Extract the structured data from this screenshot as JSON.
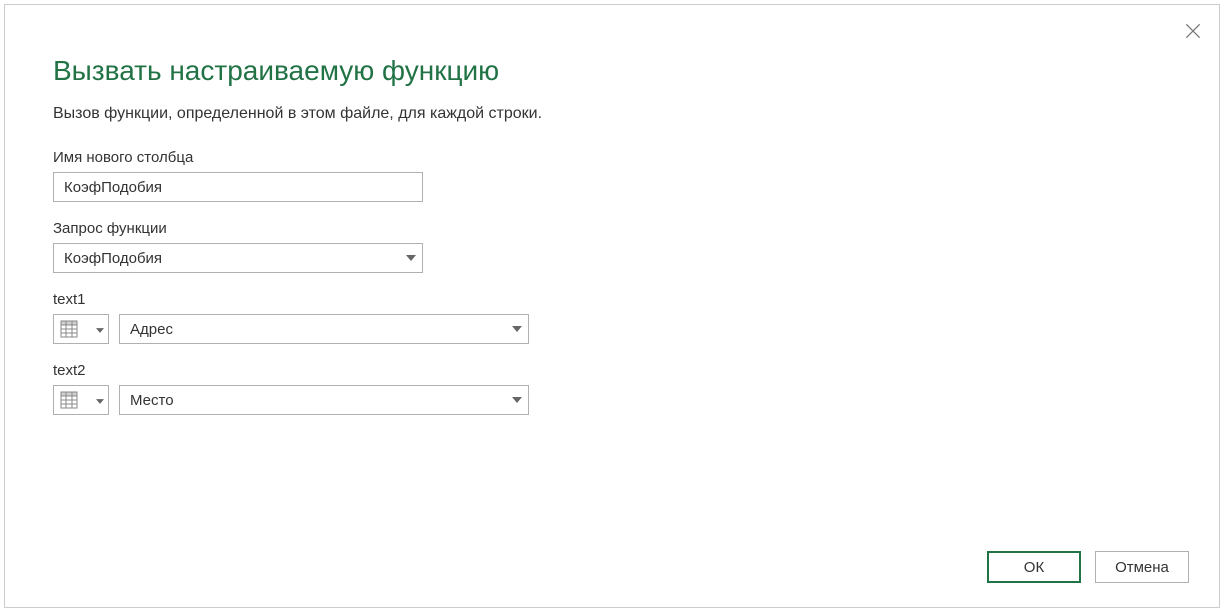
{
  "dialog": {
    "title": "Вызвать настраиваемую функцию",
    "subtitle": "Вызов функции, определенной в этом файле, для каждой строки."
  },
  "fields": {
    "column_name_label": "Имя нового столбца",
    "column_name_value": "КоэфПодобия",
    "function_query_label": "Запрос функции",
    "function_query_value": "КоэфПодобия"
  },
  "params": [
    {
      "label": "text1",
      "value": "Адрес"
    },
    {
      "label": "text2",
      "value": "Место"
    }
  ],
  "buttons": {
    "ok": "ОК",
    "cancel": "Отмена"
  }
}
